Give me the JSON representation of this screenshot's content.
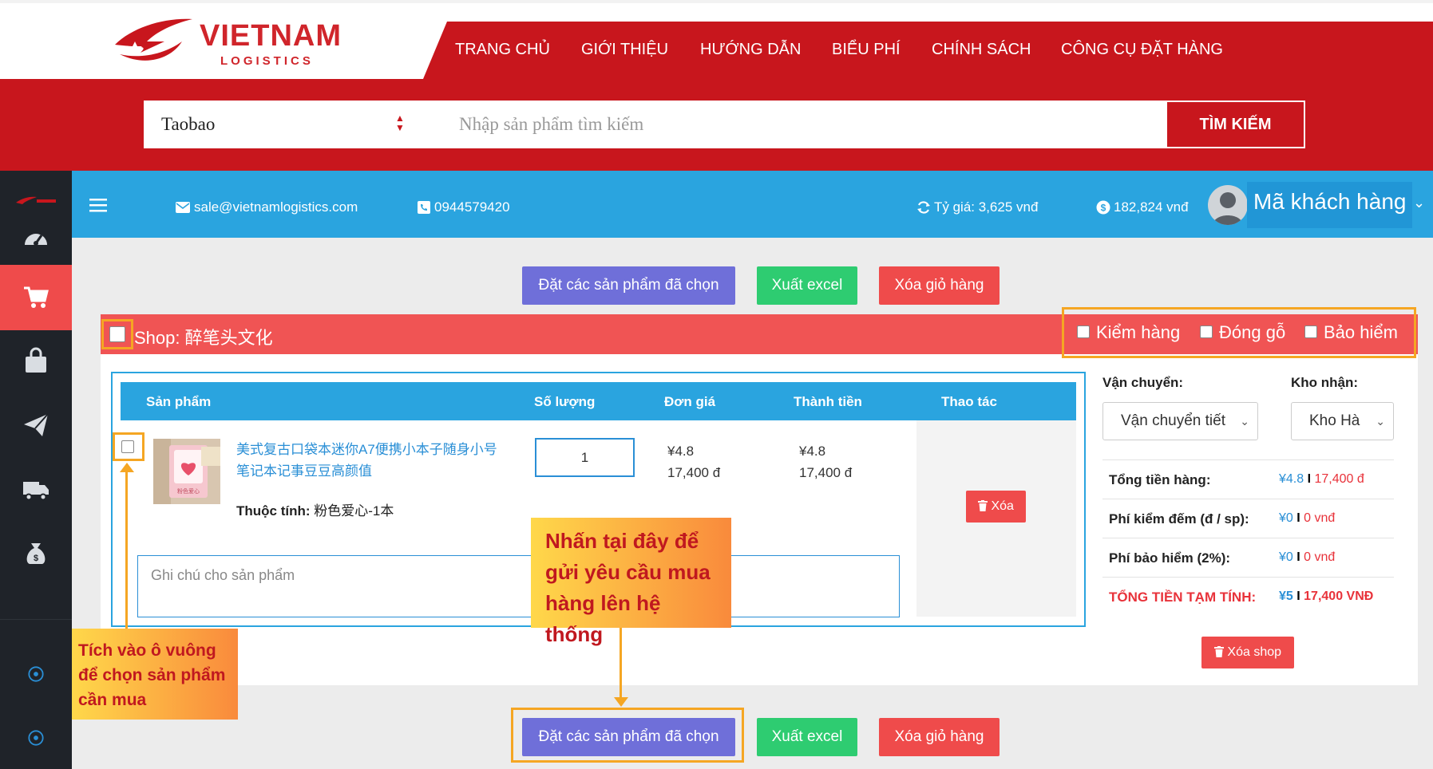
{
  "brand": {
    "name": "VIETNAM",
    "subtitle": "LOGISTICS"
  },
  "nav": {
    "items": [
      "TRANG CHỦ",
      "GIỚI THIỆU",
      "HƯỚNG DẪN",
      "BIỂU PHÍ",
      "CHÍNH SÁCH",
      "CÔNG CỤ ĐẶT HÀNG"
    ]
  },
  "search": {
    "site_selected": "Taobao",
    "placeholder": "Nhập sản phẩm tìm kiếm",
    "button_label": "TÌM KIẾM"
  },
  "topbar": {
    "email": "sale@vietnamlogistics.com",
    "phone": "0944579420",
    "exchange_rate": "Tỷ giá: 3,625 vnđ",
    "balance": "182,824 vnđ",
    "user_name": "Mã khách hàng"
  },
  "actions": {
    "order_selected": "Đặt các sản phẩm đã chọn",
    "export_excel": "Xuất excel",
    "clear_cart": "Xóa giỏ hàng"
  },
  "shop": {
    "label": "Shop: 醉笔头文化",
    "options": [
      "Kiểm hàng",
      "Đóng gỗ",
      "Bảo hiểm"
    ]
  },
  "table": {
    "headers": [
      "Sản phẩm",
      "Số lượng",
      "Đơn giá",
      "Thành tiền",
      "Thao tác"
    ]
  },
  "product": {
    "name": "美式复古口袋本迷你A7便携小本子随身小号笔记本记事豆豆高颜值",
    "attr_label": "Thuộc tính:",
    "attr_value": "粉色爱心-1本",
    "quantity": "1",
    "unit_price_cny": "¥4.8",
    "unit_price_vnd": "17,400 đ",
    "total_cny": "¥4.8",
    "total_vnd": "17,400 đ",
    "delete_label": "Xóa",
    "note_placeholder": "Ghi chú cho sản phẩm",
    "thumb_caption": "粉色爱心"
  },
  "shipping": {
    "label": "Vận chuyển:",
    "value": "Vận chuyển tiết",
    "warehouse_label": "Kho nhận:",
    "warehouse_value": "Kho Hà"
  },
  "summary": {
    "rows": [
      {
        "label": "Tổng tiền hàng:",
        "cny": "¥4.8",
        "vnd": "17,400 đ"
      },
      {
        "label": "Phí kiểm đếm (đ / sp):",
        "cny": "¥0",
        "vnd": "0 vnđ"
      },
      {
        "label": "Phí bảo hiểm (2%):",
        "cny": "¥0",
        "vnd": "0 vnđ"
      },
      {
        "label": "TỔNG TIỀN TẠM TÍNH:",
        "cny": "¥5",
        "vnd": "17,400 VNĐ"
      }
    ],
    "delete_shop": "Xóa shop"
  },
  "callouts": {
    "left": "Tích vào ô vuông để chọn sản phẩm cần mua",
    "center": "Nhấn tại đây để gửi yêu cầu mua hàng lên hệ thống"
  },
  "colors": {
    "brand_red": "#c8161d",
    "topbar_blue": "#2aa4df",
    "shop_bar": "#f05454",
    "purple_button": "#6f6fd9",
    "green_button": "#2ecc71",
    "highlight": "#f5a623"
  }
}
